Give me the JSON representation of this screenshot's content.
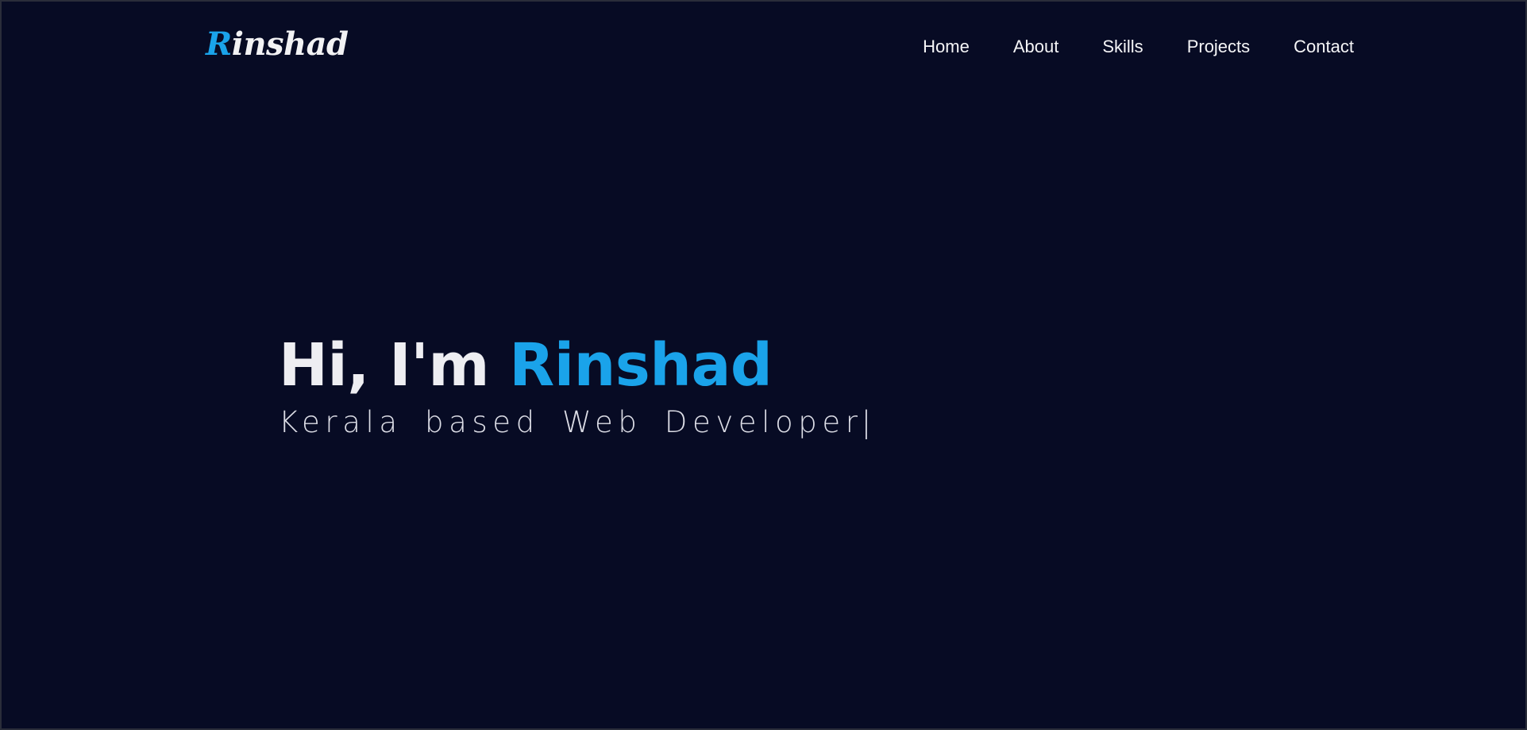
{
  "header": {
    "logo": {
      "first_letter": "R",
      "rest": "inshad"
    },
    "nav": [
      {
        "label": "Home"
      },
      {
        "label": "About"
      },
      {
        "label": "Skills"
      },
      {
        "label": "Projects"
      },
      {
        "label": "Contact"
      }
    ]
  },
  "hero": {
    "greeting": "Hi, I'm ",
    "name": "Rinshad",
    "tagline": "Kerala based Web Developer",
    "cursor": "|"
  },
  "colors": {
    "background": "#070b24",
    "accent": "#1aa3ea",
    "text": "#f2f2f4"
  }
}
